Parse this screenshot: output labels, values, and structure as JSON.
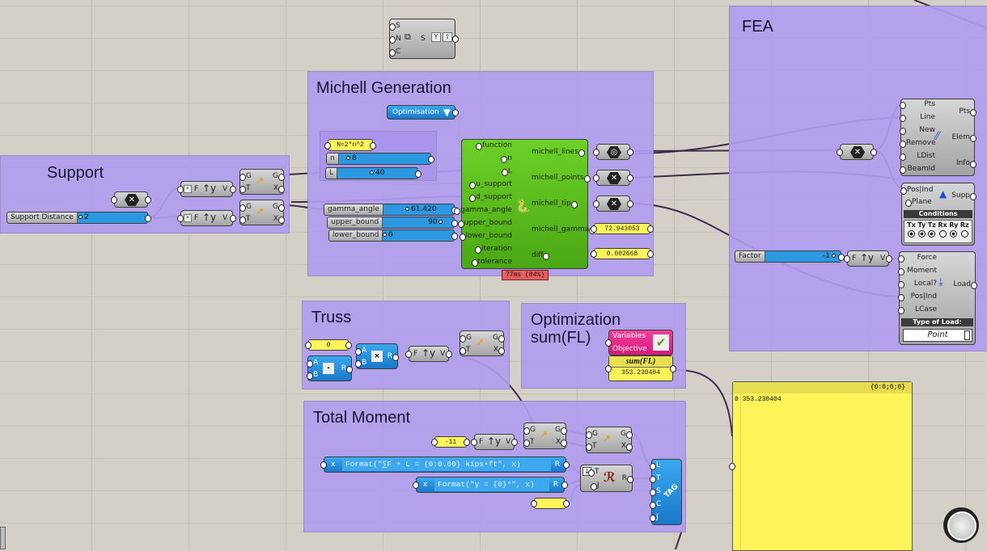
{
  "colors": {
    "canvas": "#d4d0c8",
    "group": "#b09cee",
    "python_component": "#5cc21f",
    "panel": "#fff55a",
    "galapagos": "#e8228a",
    "slider": "#2c98e0",
    "timer": "#e06060"
  },
  "groups": {
    "support": "Support",
    "michell": "Michell Generation",
    "fea": "FEA",
    "truss": "Truss",
    "optimization_line1": "Optimization",
    "optimization_line2": "sum(FL)",
    "total_moment": "Total Moment"
  },
  "top_component": {
    "inputs": [
      "S",
      "N",
      "C"
    ],
    "center": "S"
  },
  "support": {
    "slider_label": "Support Distance",
    "slider_value": "2"
  },
  "fty": {
    "f": "F",
    "icon": "↑y",
    "v": "V"
  },
  "move": {
    "g": "G",
    "t": "T",
    "x": "X"
  },
  "michell": {
    "value_list": "Optimisation",
    "formula_panel": "N=2*n^2",
    "sliders": [
      {
        "label": "n",
        "value": "8"
      },
      {
        "label": "L",
        "value": "40"
      },
      {
        "label": "gamma_angle",
        "value": "61.420"
      },
      {
        "label": "upper_bound",
        "value": "90"
      },
      {
        "label": "lower_bound",
        "value": "0"
      }
    ],
    "inputs": [
      "function",
      "n",
      "L",
      "u_support",
      "d_support",
      "gamma_angle",
      "upper_bound",
      "lower_bound",
      "iteration",
      "tolerance"
    ],
    "outputs": [
      "michell_lines",
      "michell_points",
      "michell_tip",
      "michell_gamma",
      "diff"
    ],
    "michell_gamma_value": "72.943053",
    "diff_value": "0.002668",
    "timer": "77ms (84%)"
  },
  "fea": {
    "assemble_inputs": [
      "Pts",
      "Line",
      "New",
      "Remove",
      "LDist",
      "BeamId"
    ],
    "assemble_outputs": [
      "Pts",
      "Elem",
      "Info"
    ],
    "support_inputs": [
      "Pos|Ind",
      "Plane"
    ],
    "support_output": "Supp",
    "conditions_label": "Conditions",
    "conditions": [
      {
        "axis": "Tx",
        "on": true
      },
      {
        "axis": "Ty",
        "on": true
      },
      {
        "axis": "Tz",
        "on": true
      },
      {
        "axis": "Rx",
        "on": false
      },
      {
        "axis": "Ry",
        "on": true
      },
      {
        "axis": "Rz",
        "on": false
      }
    ],
    "factor_label": "Factor",
    "factor_value": "-1",
    "load_inputs": [
      "Force",
      "Moment",
      "Local?",
      "Pos|Ind",
      "LCase"
    ],
    "load_output": "Load",
    "type_of_load_label": "Type of Load:",
    "type_of_load_value": "Point"
  },
  "truss": {
    "panel_value": "0",
    "a": "A",
    "b": "B",
    "r": "R",
    "sub_op": "-",
    "mul_op": "×"
  },
  "optimization": {
    "galapagos_variables": "Variables",
    "galapagos_objective": "Objective",
    "panel_title": "sum(FL)",
    "panel_value": "353.230404"
  },
  "total_moment": {
    "panel_value": "-11",
    "expr1_var": "x",
    "expr1": "Format(\"∑F • L = {0:0.00} kips•ft\", x)",
    "expr1_out": "R",
    "expr2_var": "x",
    "expr2": "Format(\"γ = {0}°\", x)",
    "expr2_out": "R",
    "concat_inputs": [
      "T",
      "J"
    ],
    "concat_out": "R",
    "tag_inputs": [
      "L",
      "T",
      "S",
      "C",
      "J"
    ],
    "tag_label": "TAG"
  },
  "output_panel": {
    "path": "{0:0;0;0}",
    "index": "0",
    "value": "353.230404"
  }
}
